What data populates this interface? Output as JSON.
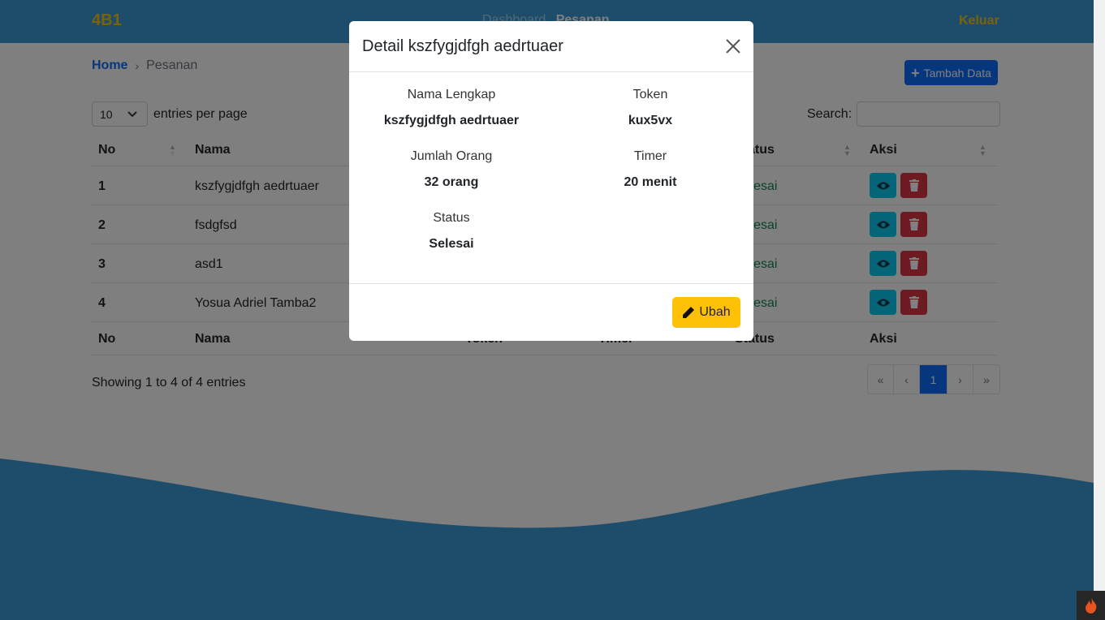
{
  "navbar": {
    "brand": "4B1",
    "links": [
      "Dashboard",
      "Pesanan"
    ],
    "logout": "Keluar"
  },
  "breadcrumb": {
    "home": "Home",
    "current": "Pesanan"
  },
  "toolbar": {
    "add_label": "Tambah Data",
    "entries_value": "10",
    "entries_label": "entries per page",
    "search_label": "Search:",
    "search_value": ""
  },
  "table": {
    "headers": [
      "No",
      "Nama",
      "Token",
      "Timer",
      "Status",
      "Aksi"
    ],
    "rows": [
      {
        "no": "1",
        "nama": "kszfygjdfgh aedrtuaer",
        "status": "Selesai"
      },
      {
        "no": "2",
        "nama": "fsdgfsd",
        "status": "Selesai"
      },
      {
        "no": "3",
        "nama": "asd1",
        "status": "Selesai"
      },
      {
        "no": "4",
        "nama": "Yosua Adriel Tamba2",
        "status": "Selesai"
      }
    ]
  },
  "footer": {
    "showing": "Showing 1 to 4 of 4 entries"
  },
  "pagination": {
    "first": "«",
    "prev": "‹",
    "current": "1",
    "next": "›",
    "last": "»"
  },
  "modal": {
    "title": "Detail kszfygjdfgh aedrtuaer",
    "fields": {
      "nama_label": "Nama Lengkap",
      "nama_value": "kszfygjdfgh aedrtuaer",
      "token_label": "Token",
      "token_value": "kux5vx",
      "jumlah_label": "Jumlah Orang",
      "jumlah_value": "32 orang",
      "timer_label": "Timer",
      "timer_value": "20 menit",
      "status_label": "Status",
      "status_value": "Selesai"
    },
    "edit_label": "Ubah"
  },
  "colors": {
    "navbar": "#3d9ad8",
    "brand": "#f5c518",
    "primary": "#0d6efd",
    "info": "#0dcaf0",
    "danger": "#dc3545",
    "warning": "#ffc107",
    "success": "#198754"
  },
  "icons": {
    "close": "close-icon",
    "view": "eye-icon",
    "delete": "trash-icon",
    "edit": "pencil-icon",
    "add": "plus-icon",
    "corner": "flame-icon"
  }
}
